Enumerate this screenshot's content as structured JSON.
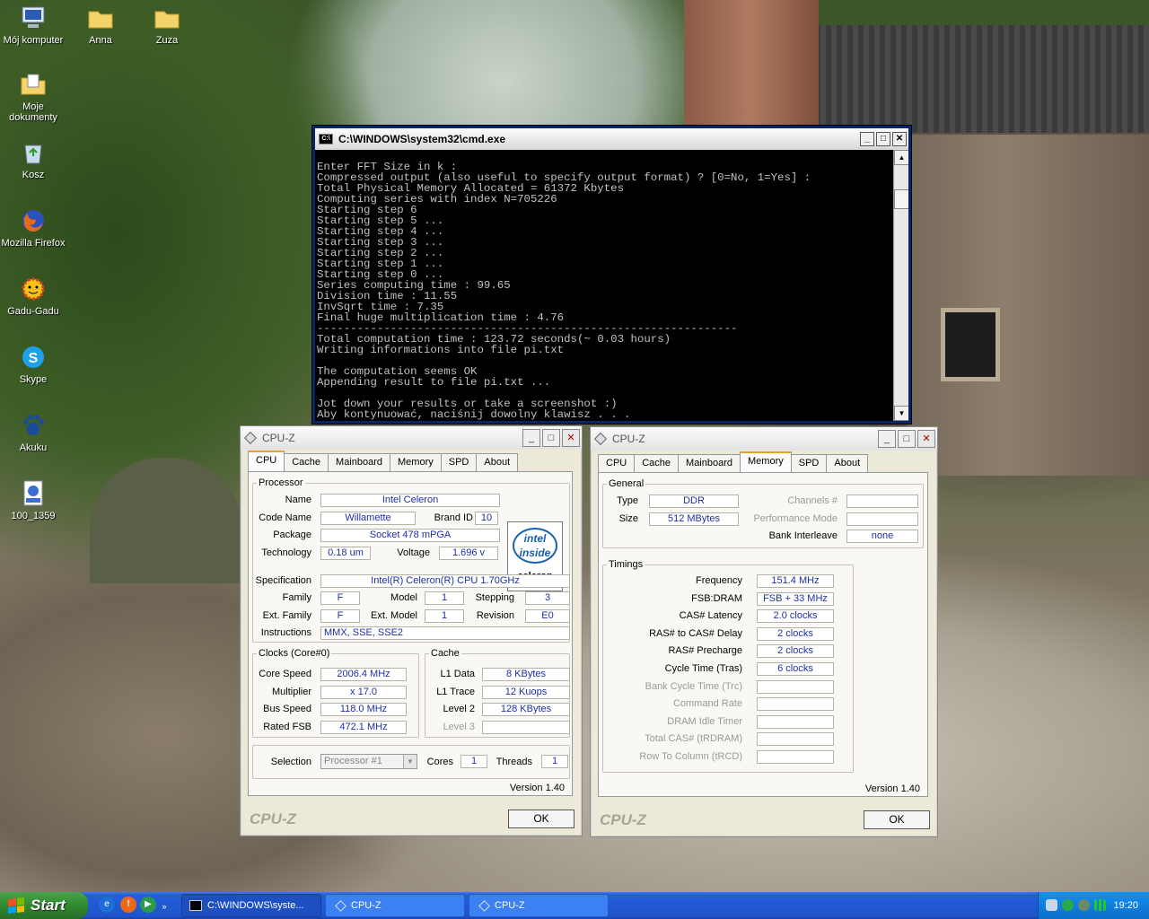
{
  "desktop": {
    "icons": [
      {
        "label": "Mój komputer",
        "icon": "computer-icon"
      },
      {
        "label": "Anna",
        "icon": "folder-icon"
      },
      {
        "label": "Zuza",
        "icon": "folder-icon"
      },
      {
        "label": "Moje dokumenty",
        "icon": "documents-folder-icon"
      },
      {
        "label": "Kosz",
        "icon": "recycle-bin-icon"
      },
      {
        "label": "Mozilla Firefox",
        "icon": "firefox-icon"
      },
      {
        "label": "Gadu-Gadu",
        "icon": "gadu-gadu-icon"
      },
      {
        "label": "Skype",
        "icon": "skype-icon"
      },
      {
        "label": "Akuku",
        "icon": "paw-icon"
      },
      {
        "label": "100_1359",
        "icon": "movie-file-icon"
      }
    ]
  },
  "cmd": {
    "title": "C:\\WINDOWS\\system32\\cmd.exe",
    "lines": [
      "Enter FFT Size in k :",
      "Compressed output (also useful to specify output format) ? [0=No, 1=Yes] :",
      "Total Physical Memory Allocated = 61372 Kbytes",
      "Computing series with index N=705226",
      "Starting step 6",
      "Starting step 5 ...",
      "Starting step 4 ...",
      "Starting step 3 ...",
      "Starting step 2 ...",
      "Starting step 1 ...",
      "Starting step 0 ...",
      "Series computing time : 99.65",
      "Division time : 11.55",
      "InvSqrt time : 7.35",
      "Final huge multiplication time : 4.76",
      "---------------------------------------------------------------",
      "Total computation time : 123.72 seconds(~ 0.03 hours)",
      "Writing informations into file pi.txt",
      "",
      "The computation seems OK",
      "Appending result to file pi.txt ...",
      "",
      "Jot down your results or take a screenshot :)",
      "Aby kontynuować, naciśnij dowolny klawisz . . ."
    ]
  },
  "cpuz1": {
    "title": "CPU-Z",
    "tabs": [
      "CPU",
      "Cache",
      "Mainboard",
      "Memory",
      "SPD",
      "About"
    ],
    "active_tab": "CPU",
    "processor": {
      "legend": "Processor",
      "name_label": "Name",
      "name": "Intel Celeron",
      "codename_label": "Code Name",
      "codename": "Willamette",
      "brandid_label": "Brand ID",
      "brandid": "10",
      "package_label": "Package",
      "package": "Socket 478 mPGA",
      "technology_label": "Technology",
      "technology": "0.18 um",
      "voltage_label": "Voltage",
      "voltage": "1.696 v",
      "spec_label": "Specification",
      "spec": "Intel(R) Celeron(R) CPU 1.70GHz",
      "family_label": "Family",
      "family": "F",
      "model_label": "Model",
      "model": "1",
      "stepping_label": "Stepping",
      "stepping": "3",
      "extfamily_label": "Ext. Family",
      "extfamily": "F",
      "extmodel_label": "Ext. Model",
      "extmodel": "1",
      "revision_label": "Revision",
      "revision": "E0",
      "instructions_label": "Instructions",
      "instructions": "MMX, SSE, SSE2",
      "logo_top": "intel inside",
      "logo_bottom": "celeron"
    },
    "clocks": {
      "legend": "Clocks (Core#0)",
      "core_speed_label": "Core Speed",
      "core_speed": "2006.4 MHz",
      "multiplier_label": "Multiplier",
      "multiplier": "x 17.0",
      "bus_speed_label": "Bus Speed",
      "bus_speed": "118.0 MHz",
      "rated_fsb_label": "Rated FSB",
      "rated_fsb": "472.1 MHz"
    },
    "cache": {
      "legend": "Cache",
      "l1data_label": "L1 Data",
      "l1data": "8 KBytes",
      "l1trace_label": "L1 Trace",
      "l1trace": "12 Kuops",
      "level2_label": "Level 2",
      "level2": "128 KBytes",
      "level3_label": "Level 3",
      "level3": ""
    },
    "selection_label": "Selection",
    "selection": "Processor #1",
    "cores_label": "Cores",
    "cores": "1",
    "threads_label": "Threads",
    "threads": "1",
    "version": "Version 1.40",
    "brand": "CPU-Z",
    "ok": "OK"
  },
  "cpuz2": {
    "title": "CPU-Z",
    "tabs": [
      "CPU",
      "Cache",
      "Mainboard",
      "Memory",
      "SPD",
      "About"
    ],
    "active_tab": "Memory",
    "general": {
      "legend": "General",
      "type_label": "Type",
      "type": "DDR",
      "size_label": "Size",
      "size": "512 MBytes",
      "channels_label": "Channels #",
      "channels": "",
      "perf_label": "Performance Mode",
      "perf": "",
      "bank_label": "Bank Interleave",
      "bank": "none"
    },
    "timings": {
      "legend": "Timings",
      "rows": [
        {
          "label": "Frequency",
          "value": "151.4 MHz",
          "enabled": true
        },
        {
          "label": "FSB:DRAM",
          "value": "FSB + 33 MHz",
          "enabled": true
        },
        {
          "label": "CAS# Latency",
          "value": "2.0 clocks",
          "enabled": true
        },
        {
          "label": "RAS# to CAS# Delay",
          "value": "2 clocks",
          "enabled": true
        },
        {
          "label": "RAS# Precharge",
          "value": "2 clocks",
          "enabled": true
        },
        {
          "label": "Cycle Time (Tras)",
          "value": "6 clocks",
          "enabled": true
        },
        {
          "label": "Bank Cycle Time (Trc)",
          "value": "",
          "enabled": false
        },
        {
          "label": "Command Rate",
          "value": "",
          "enabled": false
        },
        {
          "label": "DRAM Idle Timer",
          "value": "",
          "enabled": false
        },
        {
          "label": "Total CAS# (tRDRAM)",
          "value": "",
          "enabled": false
        },
        {
          "label": "Row To Column (tRCD)",
          "value": "",
          "enabled": false
        }
      ]
    },
    "version": "Version 1.40",
    "brand": "CPU-Z",
    "ok": "OK"
  },
  "taskbar": {
    "start": "Start",
    "items": [
      {
        "label": "C:\\WINDOWS\\syste...",
        "icon": "cmd-icon",
        "active": true
      },
      {
        "label": "CPU-Z",
        "icon": "cpuz-icon",
        "active": false
      },
      {
        "label": "CPU-Z",
        "icon": "cpuz-icon",
        "active": false
      }
    ],
    "clock": "19:20"
  }
}
